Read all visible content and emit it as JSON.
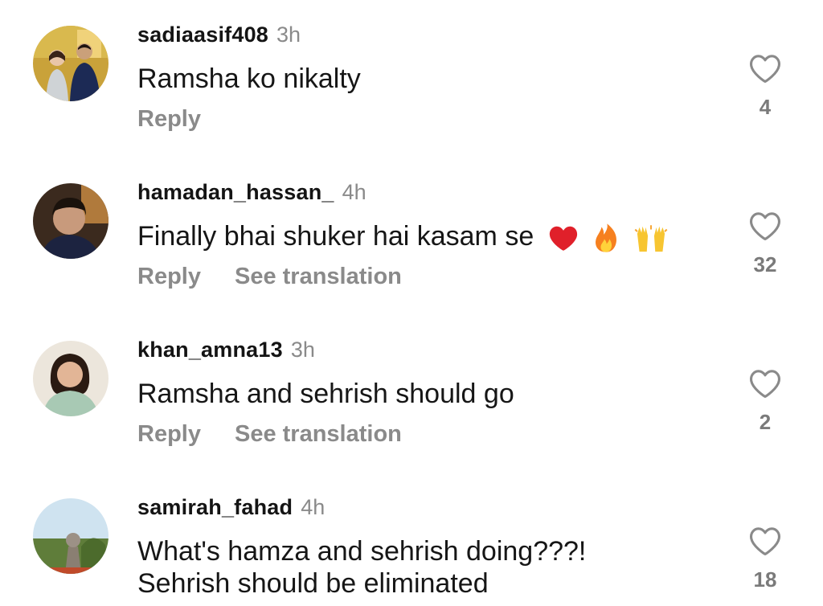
{
  "comments": [
    {
      "username": "sadiaasif408",
      "time": "3h",
      "text": "Ramsha ko nikalty",
      "reply_label": "Reply",
      "likes": "4"
    },
    {
      "username": "hamadan_hassan_",
      "time": "4h",
      "text": "Finally bhai shuker hai kasam se",
      "emojis": [
        "heart-emoji",
        "fire-emoji",
        "raising-hands-emoji"
      ],
      "reply_label": "Reply",
      "translate_label": "See translation",
      "likes": "32"
    },
    {
      "username": "khan_amna13",
      "time": "3h",
      "text": "Ramsha and sehrish should go",
      "reply_label": "Reply",
      "translate_label": "See translation",
      "likes": "2"
    },
    {
      "username": "samirah_fahad",
      "time": "4h",
      "text_line1": "What's hamza and sehrish doing???!",
      "text_line2": "Sehrish should be eliminated",
      "likes": "18"
    }
  ],
  "icons": {
    "like": "heart-outline-icon"
  },
  "colors": {
    "text": "#161616",
    "muted": "#8a8a8a",
    "background": "#ffffff"
  }
}
